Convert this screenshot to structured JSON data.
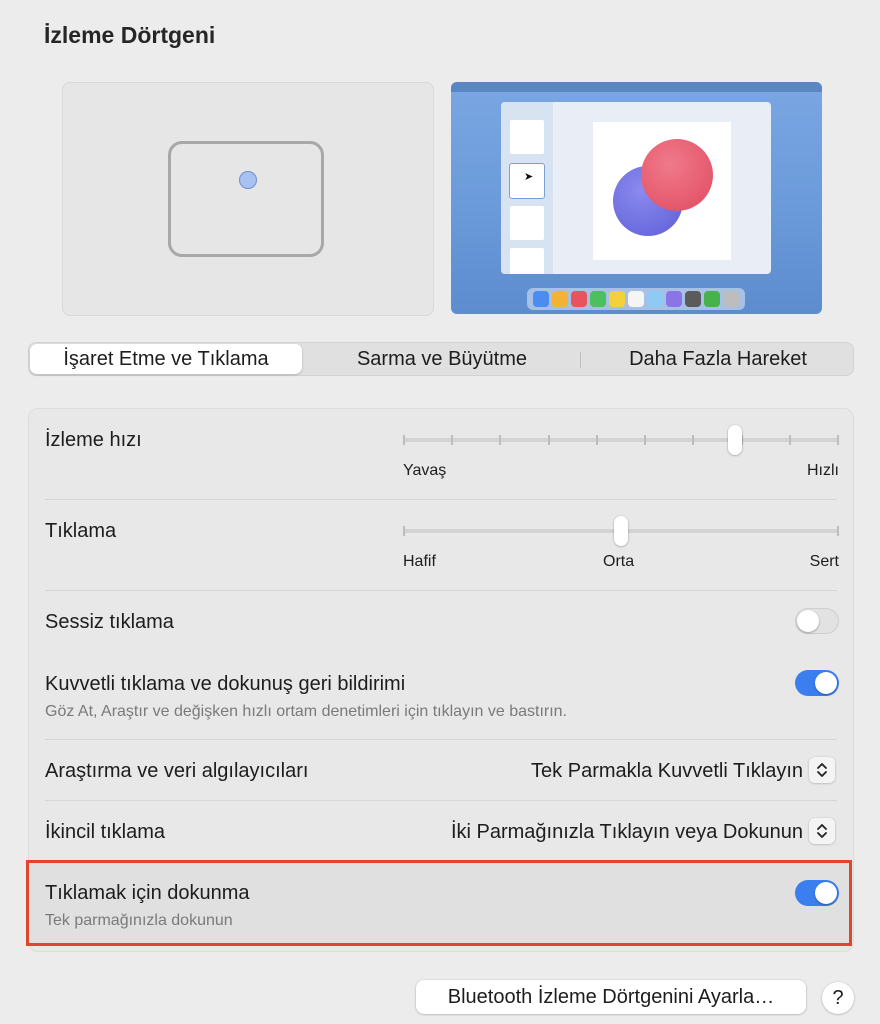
{
  "title": "İzleme Dörtgeni",
  "tabs": [
    {
      "label": "İşaret Etme ve Tıklama",
      "active": true
    },
    {
      "label": "Sarma ve Büyütme",
      "active": false
    },
    {
      "label": "Daha Fazla Hareket",
      "active": false
    }
  ],
  "tracking_speed": {
    "label": "İzleme hızı",
    "min_label": "Yavaş",
    "max_label": "Hızlı",
    "level": 0.77,
    "tick_count": 10
  },
  "click": {
    "label": "Tıklama",
    "min_label": "Hafif",
    "mid_label": "Orta",
    "max_label": "Sert",
    "level": 0.5
  },
  "silent_click": {
    "label": "Sessiz tıklama",
    "on": false
  },
  "force_click": {
    "label": "Kuvvetli tıklama ve dokunuş geri bildirimi",
    "description": "Göz At, Araştır ve değişken hızlı ortam denetimleri için tıklayın ve bastırın.",
    "on": true
  },
  "lookup": {
    "label": "Araştırma ve veri algılayıcıları",
    "value": "Tek Parmakla Kuvvetli Tıklayın"
  },
  "secondary_click": {
    "label": "İkincil tıklama",
    "value": "İki Parmağınızla Tıklayın veya Dokunun"
  },
  "tap_to_click": {
    "label": "Tıklamak için dokunma",
    "description": "Tek parmağınızla dokunun",
    "on": true
  },
  "bluetooth_button": "Bluetooth İzleme Dörtgenini Ayarla…",
  "help_button": "?",
  "colors": {
    "accent": "#3a7ef0",
    "highlight_border": "#e0452e"
  },
  "dock_colors": [
    "#4a8cf0",
    "#f2b233",
    "#e8535f",
    "#4cc05e",
    "#f4d03a",
    "#f5f5f5",
    "#8fcaf5",
    "#8b73e8",
    "#5b5b5b",
    "#47b14a",
    "#bdbdbd"
  ]
}
